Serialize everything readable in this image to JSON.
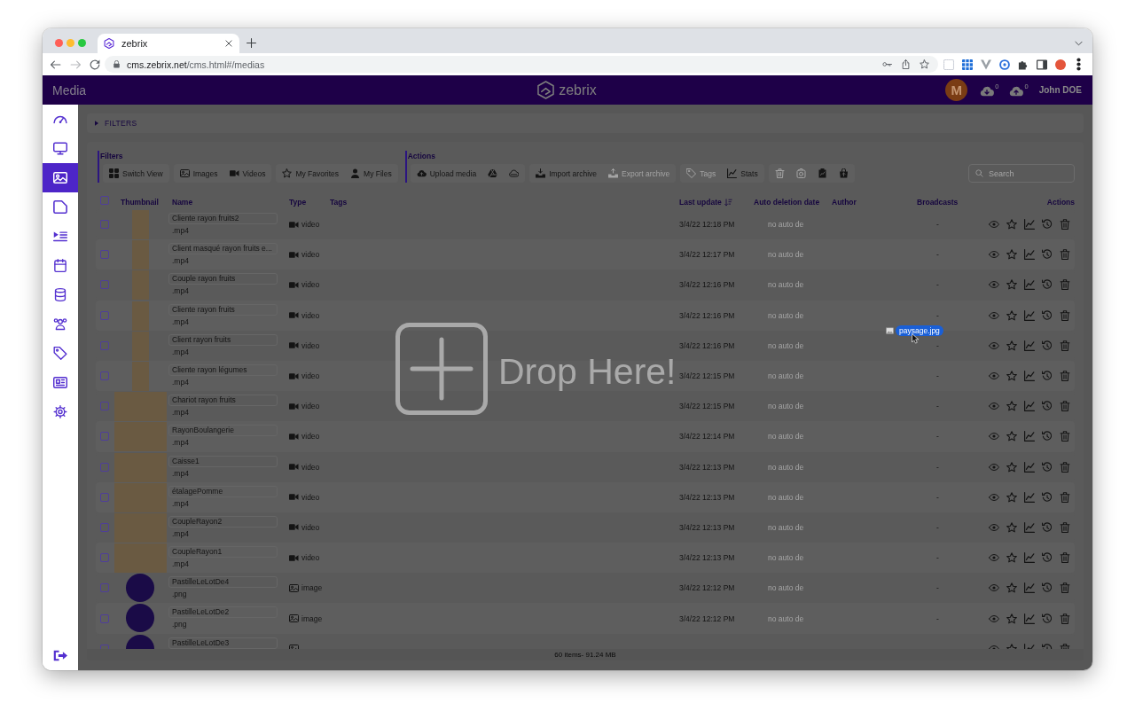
{
  "browser": {
    "tab_title": "zebrix",
    "url": "**cms.zebrix.net**/cms.html#/medias"
  },
  "header": {
    "title": "Media",
    "logo_text": "zebrix",
    "avatar_initial": "M",
    "download_count": "0",
    "upload_count": "0",
    "user_name": "John DOE"
  },
  "sidebar": {
    "items": [
      {
        "selected": false
      },
      {
        "selected": false
      },
      {
        "selected": true
      },
      {
        "selected": false
      },
      {
        "selected": false
      },
      {
        "selected": false
      },
      {
        "selected": false
      },
      {
        "selected": false
      },
      {
        "selected": false
      },
      {
        "selected": false
      },
      {
        "selected": false
      }
    ]
  },
  "filters_panel": {
    "label": "FILTERS",
    "expanded": false
  },
  "toolbar": {
    "filters": {
      "label": "Filters",
      "groups": [
        {
          "buttons": [
            {
              "label": "Switch View",
              "disabled": false
            }
          ]
        },
        {
          "buttons": [
            {
              "label": "Images",
              "disabled": false
            },
            {
              "label": "Videos",
              "disabled": false
            }
          ]
        },
        {
          "buttons": [
            {
              "label": "My Favorites",
              "disabled": false
            },
            {
              "label": "My Files",
              "disabled": false
            }
          ]
        }
      ]
    },
    "actions": {
      "label": "Actions",
      "groups": [
        {
          "buttons": [
            {
              "label": "Upload media",
              "disabled": false
            },
            {
              "disabled": false
            },
            {
              "disabled": false
            }
          ]
        },
        {
          "buttons": [
            {
              "label": "Import archive",
              "disabled": false
            },
            {
              "label": "Export archive",
              "disabled": true
            }
          ]
        },
        {
          "buttons": [
            {
              "label": "Tags",
              "disabled": true
            },
            {
              "label": "Stats",
              "disabled": false
            }
          ]
        },
        {
          "buttons": [
            {
              "disabled": true
            },
            {
              "disabled": true
            },
            {
              "disabled": false
            },
            {
              "disabled": false
            }
          ]
        }
      ]
    },
    "search": {
      "placeholder": "Search"
    }
  },
  "table": {
    "select_all": {
      "checked": false
    },
    "columns": [
      {
        "label": "Thumbnail",
        "sorted": false
      },
      {
        "label": "Name",
        "sorted": false
      },
      {
        "label": "Type",
        "sorted": false
      },
      {
        "label": "Tags",
        "sorted": false
      },
      {
        "label": "Last update",
        "sorted": true
      },
      {
        "label": "Auto deletion date",
        "sorted": false
      },
      {
        "label": "Author",
        "sorted": false
      },
      {
        "label": "Broadcasts",
        "sorted": false
      },
      {
        "label": "Actions",
        "sorted": false
      }
    ],
    "rows": [
      {
        "checked": false,
        "kind": "portraitvideo",
        "name": "Cliente rayon fruits2",
        "extension": ".mp4",
        "type": "video",
        "last_update": "3/4/22 12:18 PM",
        "auto_deletion": "no auto de",
        "broadcasts": "-"
      },
      {
        "checked": false,
        "kind": "portraitvideo",
        "name": "Client masqué rayon fruits e...",
        "extension": ".mp4",
        "type": "video",
        "last_update": "3/4/22 12:17 PM",
        "auto_deletion": "no auto de",
        "broadcasts": "-"
      },
      {
        "checked": false,
        "kind": "portraitvideo",
        "name": "Couple rayon fruits",
        "extension": ".mp4",
        "type": "video",
        "last_update": "3/4/22 12:16 PM",
        "auto_deletion": "no auto de",
        "broadcasts": "-"
      },
      {
        "checked": false,
        "kind": "portraitvideo",
        "name": "Cliente rayon fruits",
        "extension": ".mp4",
        "type": "video",
        "last_update": "3/4/22 12:16 PM",
        "auto_deletion": "no auto de",
        "broadcasts": "-"
      },
      {
        "checked": false,
        "kind": "portraitvideo",
        "name": "Client rayon fruits",
        "extension": ".mp4",
        "type": "video",
        "last_update": "3/4/22 12:16 PM",
        "auto_deletion": "no auto de",
        "broadcasts": "-"
      },
      {
        "checked": false,
        "kind": "portraitvideo",
        "name": "Cliente rayon légumes",
        "extension": ".mp4",
        "type": "video",
        "last_update": "3/4/22 12:15 PM",
        "auto_deletion": "no auto de",
        "broadcasts": "-"
      },
      {
        "checked": false,
        "kind": "landscapevideo",
        "name": "Chariot rayon fruits",
        "extension": ".mp4",
        "type": "video",
        "last_update": "3/4/22 12:15 PM",
        "auto_deletion": "no auto de",
        "broadcasts": "-"
      },
      {
        "checked": false,
        "kind": "landscapevideo",
        "name": "RayonBoulangerie",
        "extension": ".mp4",
        "type": "video",
        "last_update": "3/4/22 12:14 PM",
        "auto_deletion": "no auto de",
        "broadcasts": "-"
      },
      {
        "checked": false,
        "kind": "landscapevideo",
        "name": "Caisse1",
        "extension": ".mp4",
        "type": "video",
        "last_update": "3/4/22 12:13 PM",
        "auto_deletion": "no auto de",
        "broadcasts": "-"
      },
      {
        "checked": false,
        "kind": "landscapevideo",
        "name": "étalagePomme",
        "extension": ".mp4",
        "type": "video",
        "last_update": "3/4/22 12:13 PM",
        "auto_deletion": "no auto de",
        "broadcasts": "-"
      },
      {
        "checked": false,
        "kind": "landscapevideo",
        "name": "CoupleRayon2",
        "extension": ".mp4",
        "type": "video",
        "last_update": "3/4/22 12:13 PM",
        "auto_deletion": "no auto de",
        "broadcasts": "-"
      },
      {
        "checked": false,
        "kind": "landscapevideo",
        "name": "CoupleRayon1",
        "extension": ".mp4",
        "type": "video",
        "last_update": "3/4/22 12:13 PM",
        "auto_deletion": "no auto de",
        "broadcasts": "-"
      },
      {
        "checked": false,
        "kind": "image",
        "name": "PastilleLeLotDe4",
        "extension": ".png",
        "type": "image",
        "last_update": "3/4/22 12:12 PM",
        "auto_deletion": "no auto de",
        "broadcasts": "-"
      },
      {
        "checked": false,
        "kind": "image",
        "name": "PastilleLeLotDe2",
        "extension": ".png",
        "type": "image",
        "last_update": "3/4/22 12:12 PM",
        "auto_deletion": "no auto de",
        "broadcasts": "-"
      },
      {
        "checked": false,
        "kind": "image",
        "name": "PastilleLeLotDe3"
      }
    ],
    "footer": "60 items- 91.24 MB"
  },
  "drop_zone": {
    "message": "Drop Here!"
  },
  "drag": {
    "file_name": "paysage.jpg"
  }
}
